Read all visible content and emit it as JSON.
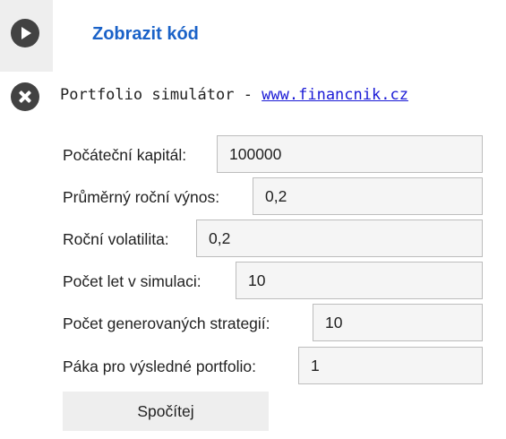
{
  "toolbar": {
    "run_icon": "play-icon",
    "show_code_label": "Zobrazit kód"
  },
  "output": {
    "close_icon": "close-icon",
    "title_prefix": "Portfolio simulátor - ",
    "title_link": "www.financnik.cz"
  },
  "form": {
    "fields": [
      {
        "label": "Počáteční kapitál:",
        "value": "100000"
      },
      {
        "label": "Průměrný roční výnos:",
        "value": "0,2"
      },
      {
        "label": "Roční volatilita:",
        "value": "0,2"
      },
      {
        "label": "Počet let v simulaci:",
        "value": "10"
      },
      {
        "label": "Počet generovaných strategií:",
        "value": "10"
      },
      {
        "label": "Páka pro výsledné portfolio:",
        "value": "1"
      }
    ],
    "submit_label": "Spočítej"
  },
  "colors": {
    "link_blue": "#1a62c8",
    "url_blue": "#1a1ad6",
    "button_dark": "#424242",
    "input_bg": "#f5f5f5"
  }
}
